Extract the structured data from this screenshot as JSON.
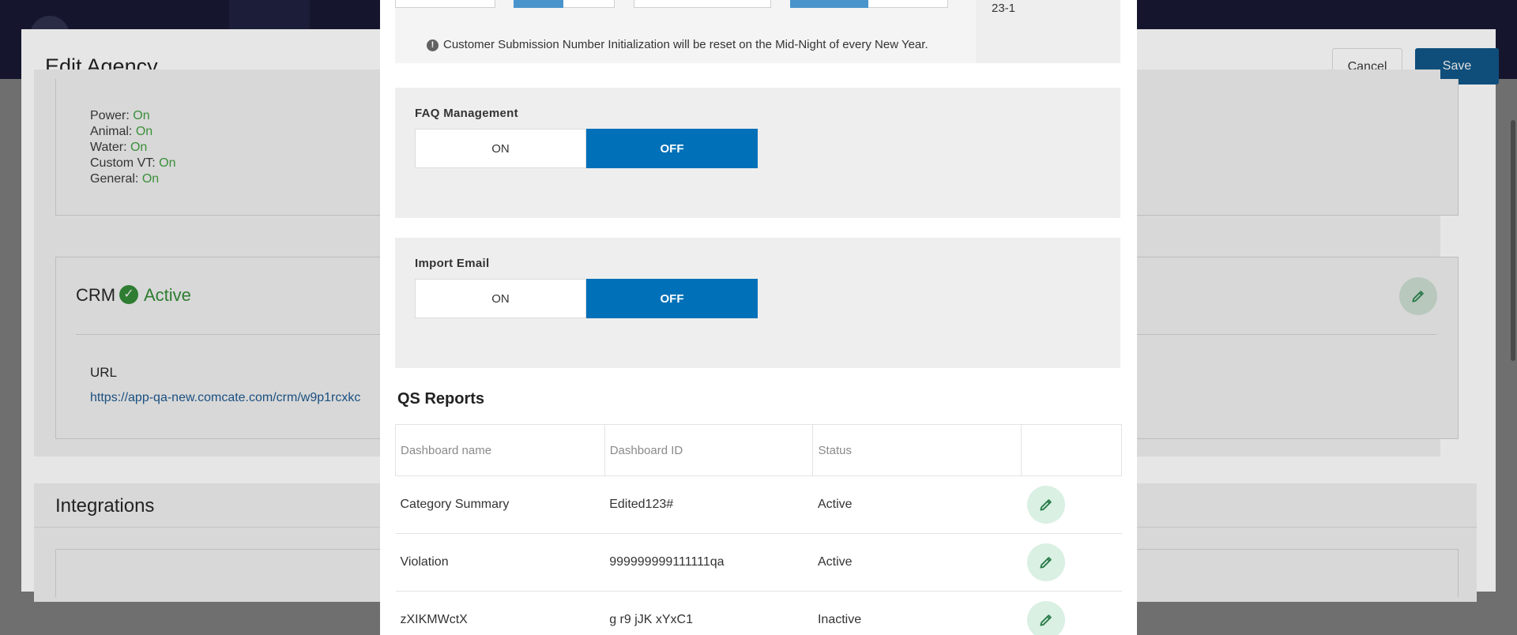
{
  "page": {
    "title": "Edit Agency",
    "cancel_label": "Cancel",
    "save_label": "Save"
  },
  "violation_types": [
    {
      "label": "Power:",
      "value": "On"
    },
    {
      "label": "Animal:",
      "value": "On"
    },
    {
      "label": "Water:",
      "value": "On"
    },
    {
      "label": "Custom VT:",
      "value": "On"
    },
    {
      "label": "General:",
      "value": "On"
    }
  ],
  "crm": {
    "title": "CRM",
    "status": "Active",
    "url_label": "URL",
    "url": "https://app-qa-new.comcate.com/crm/w9p1rcxkc"
  },
  "integrations": {
    "title": "Integrations"
  },
  "modal": {
    "side_value": "23-1",
    "info_text": "Customer Submission Number Initialization will be reset on the Mid-Night of every New Year.",
    "faq": {
      "label": "FAQ Management",
      "on_label": "ON",
      "off_label": "OFF",
      "selected": "OFF"
    },
    "import_email": {
      "label": "Import Email",
      "on_label": "ON",
      "off_label": "OFF",
      "selected": "OFF"
    },
    "qs_reports": {
      "title": "QS Reports",
      "headers": [
        "Dashboard name",
        "Dashboard ID",
        "Status",
        ""
      ],
      "rows": [
        {
          "name": "Category Summary",
          "id": "Edited123#",
          "status": "Active"
        },
        {
          "name": "Violation",
          "id": "999999999111111qa",
          "status": "Active"
        },
        {
          "name": "zXIKMWctX",
          "id": "g r9 jJK xYxC1",
          "status": "Inactive"
        }
      ]
    }
  },
  "colors": {
    "toggle_selected": "#0070b8",
    "save_button": "#0f4e7b",
    "active_green": "#2e7d32",
    "edit_icon_bg": "#d9f0e3"
  },
  "icons": [
    "check-circle-icon",
    "pencil-icon",
    "info-icon"
  ]
}
